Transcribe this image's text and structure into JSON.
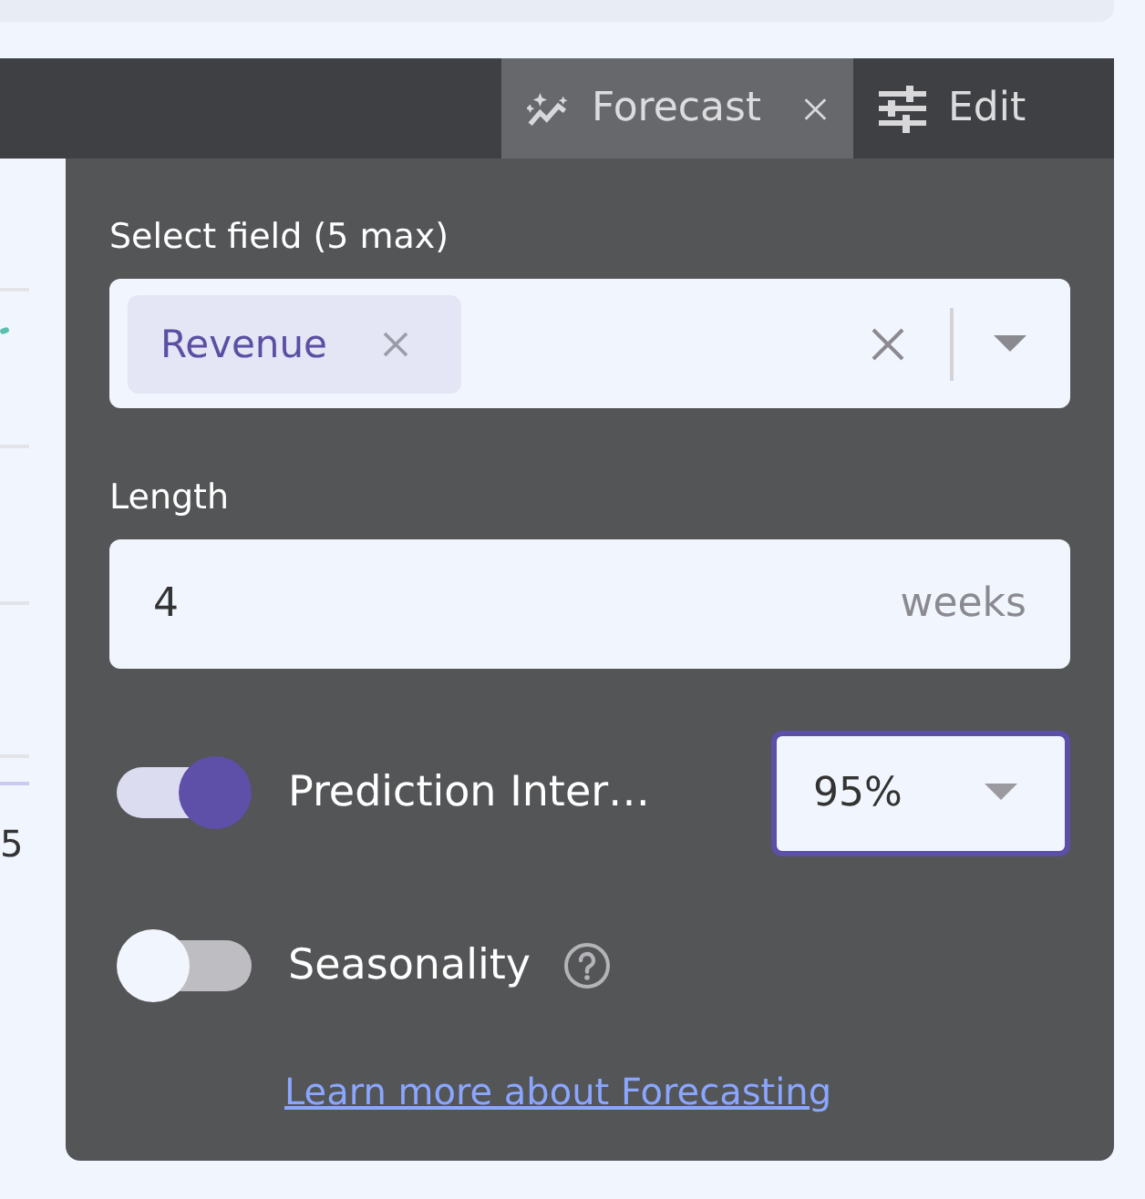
{
  "toolbar": {
    "tabs": [
      {
        "label": "Forecast",
        "selected": true,
        "closable": true
      },
      {
        "label": "Edit",
        "selected": false,
        "closable": false
      }
    ]
  },
  "background_chart": {
    "axis_label": "5"
  },
  "panel": {
    "field_select": {
      "label": "Select field (5 max)",
      "chips": [
        "Revenue"
      ]
    },
    "length": {
      "label": "Length",
      "value": "4",
      "suffix": "weeks"
    },
    "options": [
      {
        "kind": "interval",
        "label": "Prediction Inter…",
        "on": true,
        "select_value": "95%"
      },
      {
        "kind": "help",
        "label": "Seasonality",
        "on": false
      }
    ],
    "link": "Learn more about Forecasting"
  }
}
